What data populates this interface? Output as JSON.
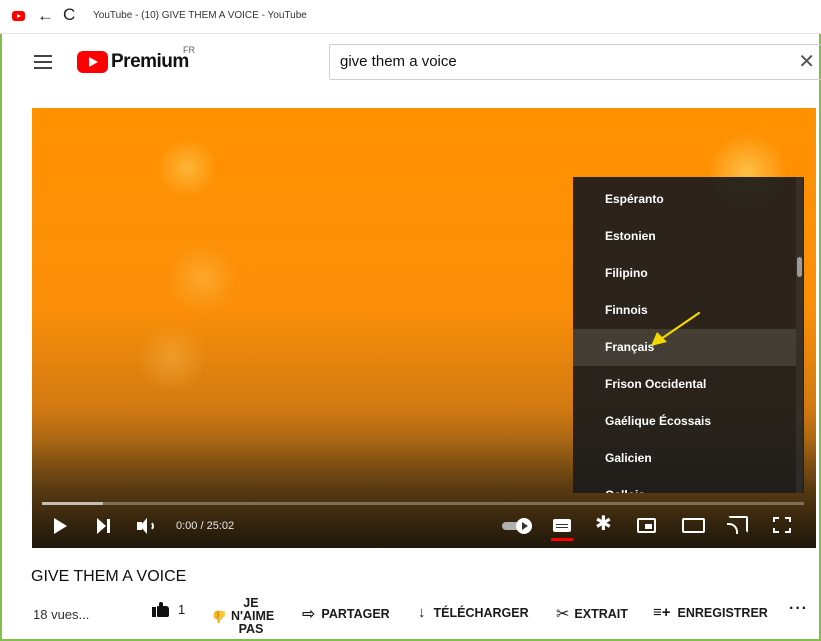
{
  "window": {
    "title": "YouTube - (10) GIVE THEM A VOICE - YouTube"
  },
  "masthead": {
    "logo_text": "Premium",
    "region": "FR",
    "search_value": "give them a voice",
    "clear_glyph": "✕"
  },
  "player": {
    "languages": [
      {
        "label": "Espéranto",
        "highlighted": false
      },
      {
        "label": "Estonien",
        "highlighted": false
      },
      {
        "label": "Filipino",
        "highlighted": false
      },
      {
        "label": "Finnois",
        "highlighted": false
      },
      {
        "label": "Français",
        "highlighted": true
      },
      {
        "label": "Frison Occidental",
        "highlighted": false
      },
      {
        "label": "Gaélique Écossais",
        "highlighted": false
      },
      {
        "label": "Galicien",
        "highlighted": false
      },
      {
        "label": "Gallois",
        "highlighted": false
      }
    ],
    "time_display": "0:00 / 25:02",
    "buffered_fraction": 0.08,
    "annotation_color": "#f5d800",
    "subtitles_active_color": "#ff0000"
  },
  "video": {
    "title": "GIVE THEM A VOICE",
    "views": "18 vues...",
    "like_count": "1",
    "dislike_label": "JE N'AIME PAS",
    "share_label": "PARTAGER",
    "download_label": "TÉLÉCHARGER",
    "clip_label": "EXTRAIT",
    "save_label": "ENREGISTRER",
    "more_glyph": "···"
  },
  "icons": {
    "back": "←",
    "reload": "C",
    "settings": "✱",
    "share": "⇨",
    "download": "↓",
    "clip": "✂",
    "save": "≡+",
    "dislike": "👍"
  }
}
